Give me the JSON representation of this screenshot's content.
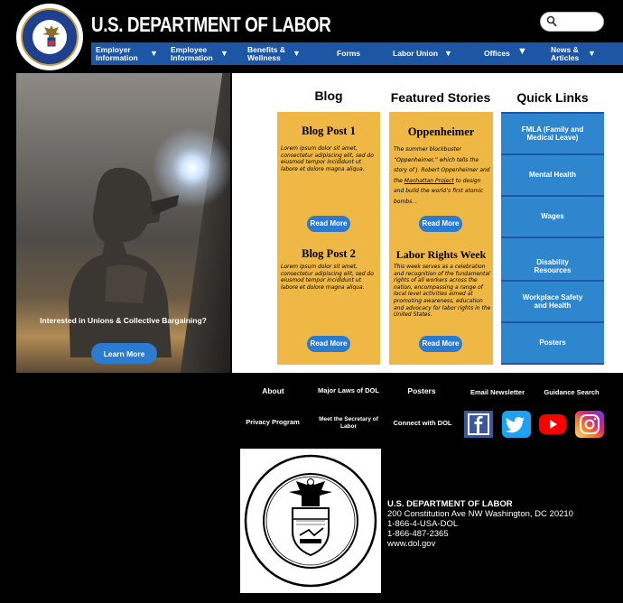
{
  "header": {
    "title": "U.S. DEPARTMENT OF LABOR",
    "search_placeholder": "",
    "seal_text": "DEPARTMENT OF LABOR · UNITED STATES OF AMERICA"
  },
  "nav": {
    "items": [
      {
        "label": "Employer Information"
      },
      {
        "label": "Employee Information"
      },
      {
        "label": "Benefits & Wellness"
      },
      {
        "label": "Forms"
      },
      {
        "label": "Labor Union"
      },
      {
        "label": "Offices"
      },
      {
        "label": "News & Articles"
      }
    ]
  },
  "hero": {
    "caption": "Interested in Unions & Collective Bargaining?",
    "button": "Learn More"
  },
  "columns": {
    "blog": "Blog",
    "featured": "Featured Stories",
    "quick": "Quick Links"
  },
  "blog": [
    {
      "title": "Blog Post 1",
      "body": "Lorem ipsum dolor sit amet, consectetur adipiscing elit, sed do eiusmod tempor incididunt ut labore et dolore magna aliqua.",
      "button": "Read More"
    },
    {
      "title": "Blog Post 2",
      "body": "Lorem ipsum dolor sit amet, consectetur adipiscing elit, sed do eiusmod tempor incididunt ut labore et dolore magna aliqua.",
      "button": "Read More"
    }
  ],
  "featured": [
    {
      "title": "Oppenheimer",
      "body_pre": "The summer blockbuster “Oppenheimer,” which tells the story of J. Robert Oppenheimer and the ",
      "body_link": "Manhattan Project",
      "body_post": " to design and build the world’s first atomic bombs…",
      "button": "Read More"
    },
    {
      "title": "Labor Rights Week",
      "body": "This week serves as a celebration and recognition of the fundamental rights of all workers across the nation, encompassing a range of local level activities aimed at promoting awareness, education and advocacy for labor rights in the United States.",
      "button": "Read More"
    }
  ],
  "quick_links": [
    {
      "label": "FMLA (Family and Medical Leave)"
    },
    {
      "label": "Mental Health"
    },
    {
      "label": "Wages"
    },
    {
      "label": "Disability Resources"
    },
    {
      "label": "Workplace Safety and Health"
    },
    {
      "label": "Posters"
    }
  ],
  "footer": {
    "links_row1": [
      "About",
      "Major Laws of DOL",
      "Posters",
      "Email Newsletter",
      "Guidance Search"
    ],
    "links_row2": [
      "Privacy Program",
      "Meet the Secretary of Labor",
      "Connect with DOL"
    ],
    "social": [
      "facebook-icon",
      "twitter-icon",
      "youtube-icon",
      "instagram-icon"
    ],
    "address": {
      "name": "U.S. DEPARTMENT OF LABOR",
      "street": "200 Constitution Ave NW Washington, DC 20210",
      "phone1": "1-866-4-USA-DOL",
      "phone2": "1-866-487-2365",
      "web": "www.dol.gov"
    },
    "seal_text_top": "DEPARTMENT OF LABOR",
    "seal_text_bottom": "UNITED STATES OF AMERICA"
  },
  "colors": {
    "nav_blue": "#1d56a4",
    "button_blue": "#2b7bd1",
    "quick_link_blue": "#2e86cf",
    "card_gold": "#efb744"
  }
}
